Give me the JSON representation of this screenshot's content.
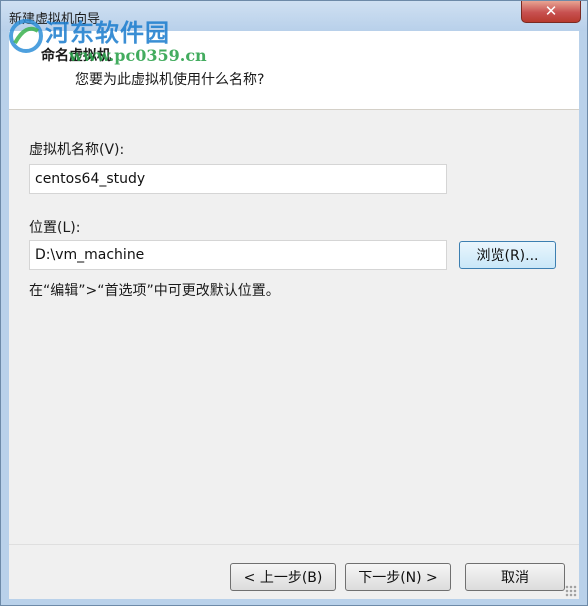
{
  "window": {
    "title": "新建虚拟机向导"
  },
  "watermark": {
    "brand": "河东软件园",
    "url": "www.pc0359.cn"
  },
  "header": {
    "title": "命名虚拟机",
    "subtitle": "您要为此虚拟机使用什么名称?"
  },
  "form": {
    "vm_name_label": "虚拟机名称(V):",
    "vm_name_value": "centos64_study",
    "location_label": "位置(L):",
    "location_value": "D:\\vm_machine",
    "browse_label": "浏览(R)...",
    "hint": "在“编辑”>“首选项”中可更改默认位置。"
  },
  "footer": {
    "back_label": "< 上一步(B)",
    "next_label": "下一步(N) >",
    "cancel_label": "取消"
  },
  "colors": {
    "titlebar": "#b9d1ea",
    "close": "#c75050",
    "accent": "#3c7fb1"
  }
}
